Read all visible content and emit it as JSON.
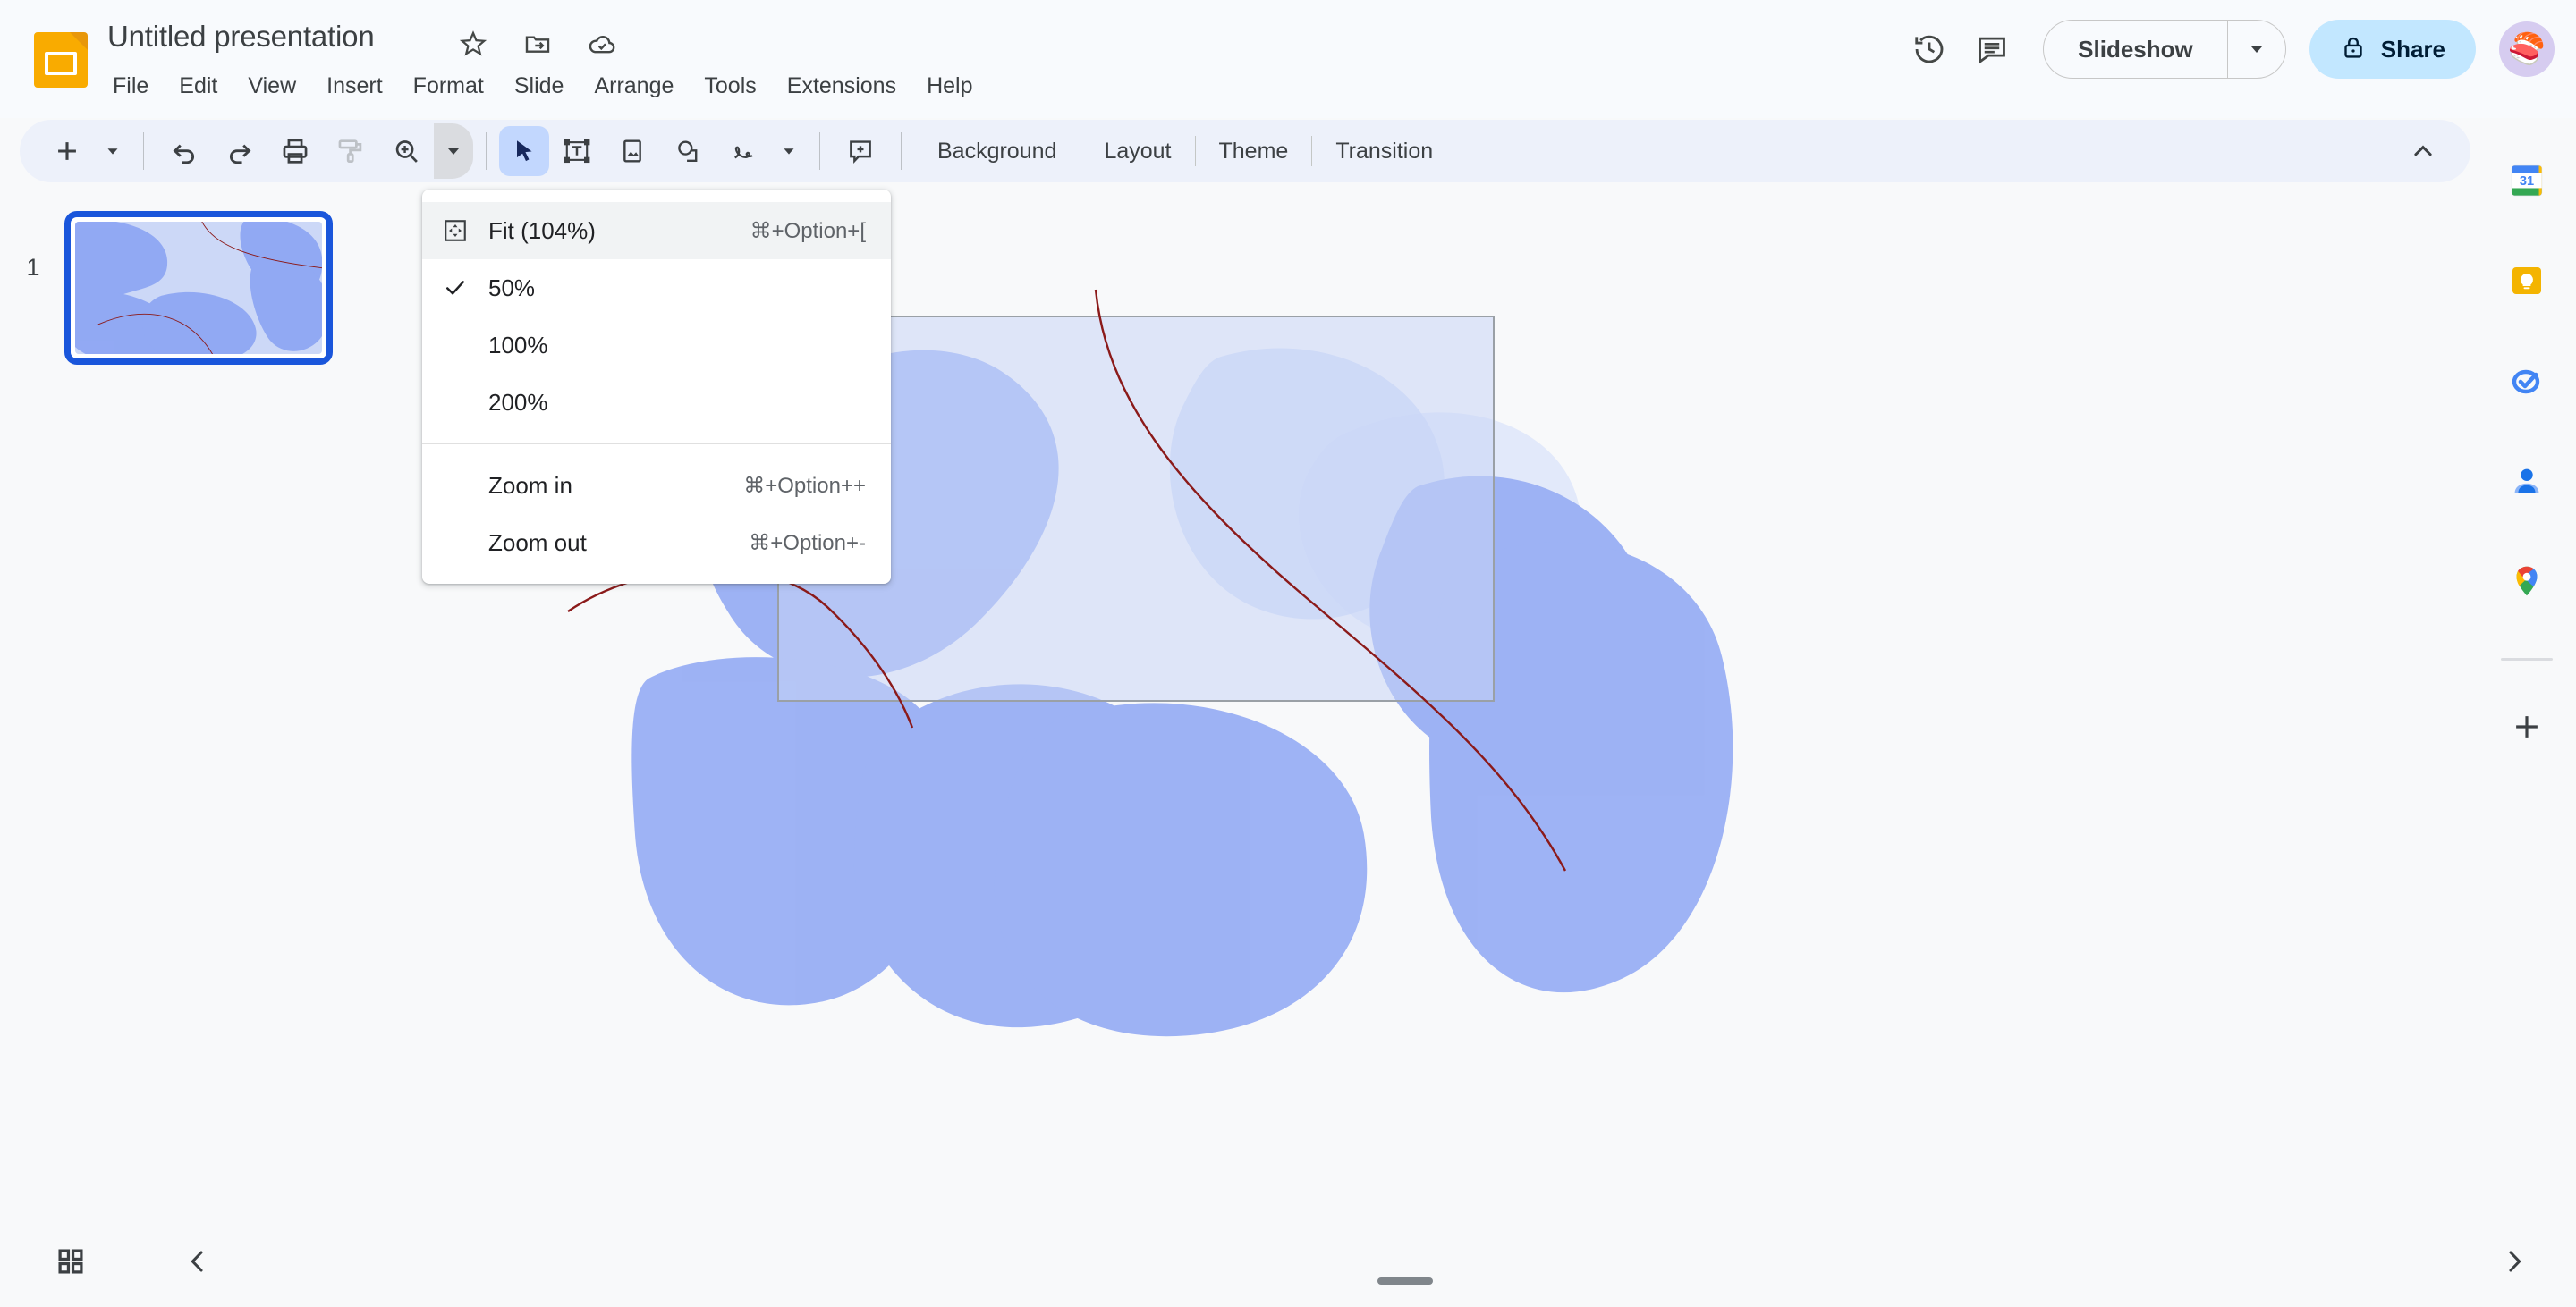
{
  "app": {
    "name": "Google Slides",
    "logo_icon": "slides-logo-icon"
  },
  "header": {
    "title": "Untitled presentation",
    "title_icons": [
      {
        "name": "star-icon",
        "label": "Star"
      },
      {
        "name": "move-to-folder-icon",
        "label": "Move"
      },
      {
        "name": "cloud-saved-icon",
        "label": "Saved to Drive"
      }
    ],
    "menus": [
      "File",
      "Edit",
      "View",
      "Insert",
      "Format",
      "Slide",
      "Arrange",
      "Tools",
      "Extensions",
      "Help"
    ],
    "right": {
      "history_icon": "version-history-icon",
      "comments_icon": "comment-icon",
      "slideshow_label": "Slideshow",
      "slideshow_caret": "chevron-down-icon",
      "share_label": "Share",
      "share_lock_icon": "lock-icon",
      "avatar_glyph": "🍣"
    }
  },
  "toolbar": {
    "new_label": "+",
    "items": [
      {
        "name": "new-slide-button",
        "icon": "plus-icon"
      },
      {
        "name": "new-slide-dropdown",
        "icon": "caret-down-icon"
      },
      {
        "name": "undo-button",
        "icon": "undo-icon"
      },
      {
        "name": "redo-button",
        "icon": "redo-icon"
      },
      {
        "name": "print-button",
        "icon": "print-icon"
      },
      {
        "name": "paint-format-button",
        "icon": "paint-roller-icon"
      },
      {
        "name": "zoom-button",
        "icon": "zoom-in-icon"
      },
      {
        "name": "zoom-dropdown-button",
        "icon": "caret-down-icon"
      },
      {
        "name": "select-tool-button",
        "icon": "cursor-arrow-icon"
      },
      {
        "name": "text-box-button",
        "icon": "text-box-icon"
      },
      {
        "name": "insert-image-button",
        "icon": "image-icon"
      },
      {
        "name": "insert-shape-button",
        "icon": "shape-icon"
      },
      {
        "name": "insert-line-button",
        "icon": "scribble-line-icon"
      },
      {
        "name": "insert-line-dropdown",
        "icon": "caret-down-icon"
      },
      {
        "name": "add-comment-button",
        "icon": "add-comment-icon"
      }
    ],
    "text_buttons": [
      "Background",
      "Layout",
      "Theme",
      "Transition"
    ],
    "collapse_icon": "chevron-up-icon"
  },
  "zoom_menu": {
    "items": [
      {
        "label": "Fit (104%)",
        "shortcut": "⌘+Option+[",
        "checked": false,
        "highlighted": true,
        "icon": "fit-to-screen-icon"
      },
      {
        "label": "50%",
        "shortcut": "",
        "checked": true,
        "highlighted": false,
        "icon": "check-icon"
      },
      {
        "label": "100%",
        "shortcut": "",
        "checked": false,
        "highlighted": false,
        "icon": ""
      },
      {
        "label": "200%",
        "shortcut": "",
        "checked": false,
        "highlighted": false,
        "icon": ""
      }
    ],
    "items_after_divider": [
      {
        "label": "Zoom in",
        "shortcut": "⌘+Option++",
        "icon": ""
      },
      {
        "label": "Zoom out",
        "shortcut": "⌘+Option+-",
        "icon": ""
      }
    ]
  },
  "filmstrip": {
    "slides": [
      {
        "number": "1",
        "selected": true
      }
    ]
  },
  "side_rail": {
    "icons": [
      {
        "name": "google-calendar-icon",
        "label": "Calendar",
        "badge": "31"
      },
      {
        "name": "google-keep-icon",
        "label": "Keep"
      },
      {
        "name": "google-tasks-icon",
        "label": "Tasks"
      },
      {
        "name": "google-contacts-icon",
        "label": "Contacts"
      },
      {
        "name": "google-maps-icon",
        "label": "Maps"
      }
    ],
    "add_icon": "plus-icon"
  },
  "bottom_bar": {
    "grid_view_icon": "grid-view-icon",
    "prev_icon": "chevron-left-icon",
    "next_icon": "chevron-right-icon",
    "notes_handle": "notes-resize-handle"
  },
  "slide_canvas": {
    "theme_colors": {
      "blob_base": "#8fa8f5",
      "blob_overlap": "#5f7ff0",
      "blob_light": "#ccd8f7",
      "line_red": "#8b1a1a",
      "rect_fill": "#c9d6f5",
      "rect_border": "#9aa0a6",
      "background": "#f8f9fa"
    }
  }
}
